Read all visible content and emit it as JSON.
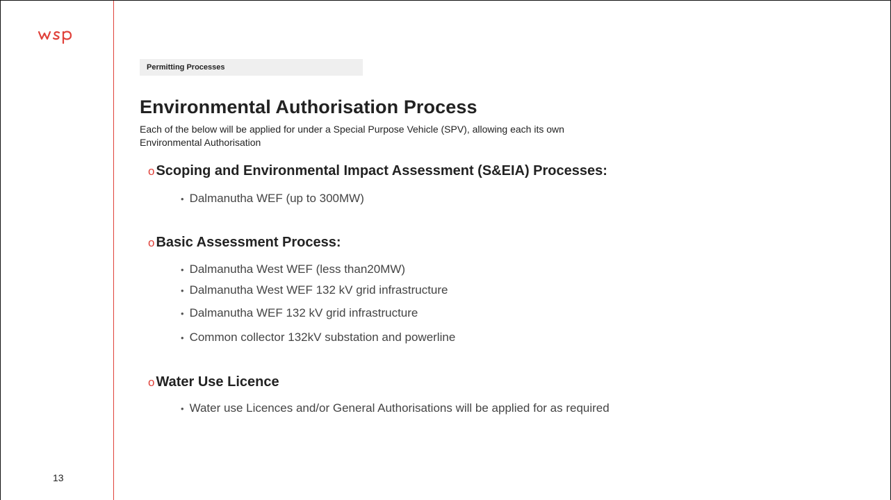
{
  "slide": {
    "page_number": "13",
    "section_tag": "Permitting Processes",
    "title": "Environmental Authorisation Process",
    "subtitle": "Each of the below will be applied for under a Special Purpose Vehicle (SPV), allowing each its own Environmental Authorisation",
    "sections": [
      {
        "heading": "Scoping and Environmental Impact Assessment (S&EIA) Processes:",
        "items": [
          "Dalmanutha WEF (up to 300MW)"
        ]
      },
      {
        "heading": "Basic Assessment Process:",
        "items": [
          "Dalmanutha West WEF (less than20MW)",
          "Dalmanutha West WEF 132 kV grid infrastructure",
          "Dalmanutha WEF 132 kV grid infrastructure",
          "Common collector 132kV substation and powerline"
        ]
      },
      {
        "heading": "Water Use Licence",
        "items": [
          "Water use Licences and/or General Authorisations will be applied for as required"
        ]
      }
    ]
  },
  "logo": {
    "text": "wsp",
    "color": "#e0413a"
  },
  "colors": {
    "accent": "#e0413a",
    "text": "#222222",
    "tag_background": "#efefef"
  }
}
